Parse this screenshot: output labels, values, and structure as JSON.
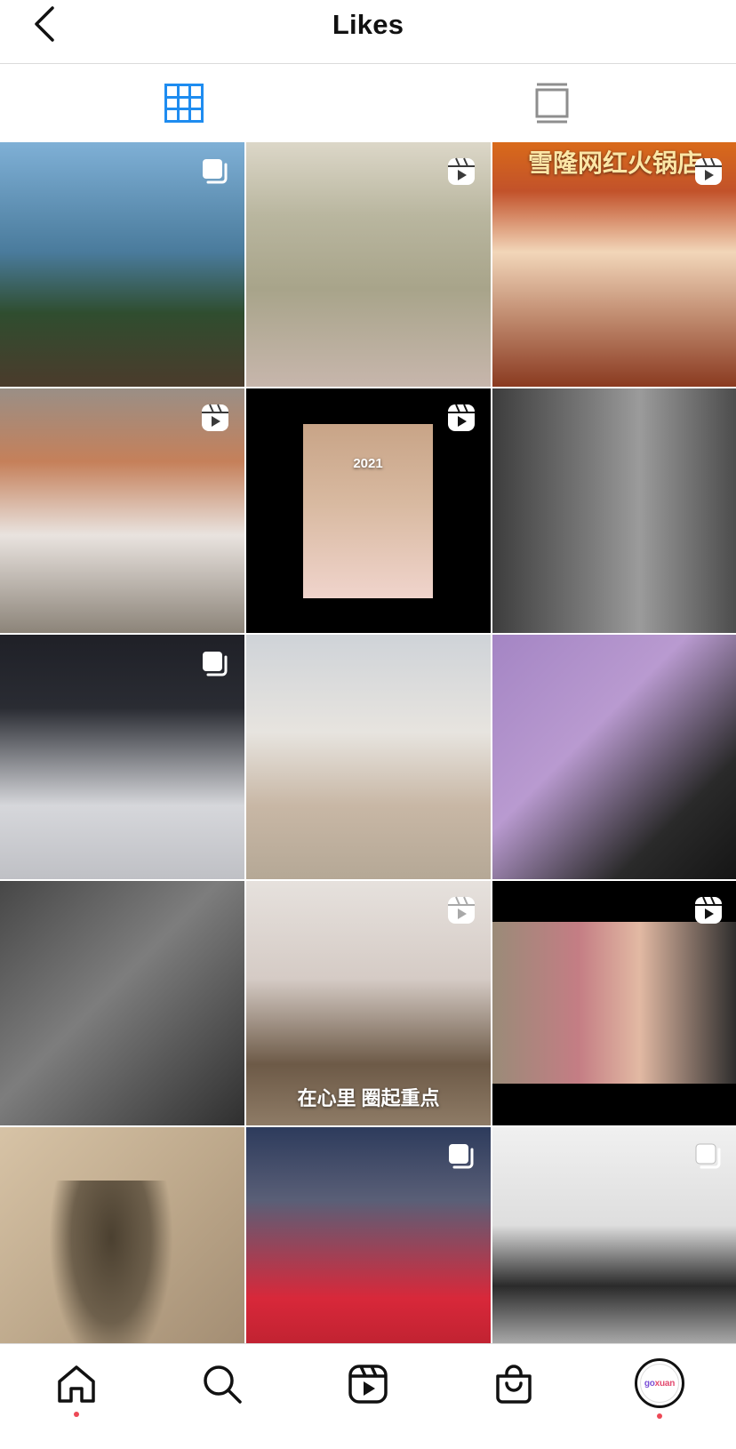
{
  "header": {
    "title": "Likes",
    "back_icon": "chevron-left-icon"
  },
  "tabs": [
    {
      "id": "grid",
      "icon": "grid-icon",
      "active": true
    },
    {
      "id": "feed",
      "icon": "single-post-icon",
      "active": false
    }
  ],
  "colors": {
    "active_tab": "#1e8cf0",
    "inactive_tab": "#8e8e8e",
    "notification_dot": "#ed4956"
  },
  "posts": [
    {
      "badge": "multi-photo-icon"
    },
    {
      "badge": "reel-icon"
    },
    {
      "badge": "reel-icon",
      "overlay": "雪隆网红火锅店"
    },
    {
      "badge": "reel-icon"
    },
    {
      "badge": "reel-icon",
      "overlay": "2021"
    },
    {
      "badge": ""
    },
    {
      "badge": "multi-photo-icon"
    },
    {
      "badge": ""
    },
    {
      "badge": ""
    },
    {
      "badge": ""
    },
    {
      "badge": "reel-icon",
      "overlay": "在心里 圈起重点"
    },
    {
      "badge": "reel-icon"
    },
    {
      "badge": ""
    },
    {
      "badge": "multi-photo-icon"
    },
    {
      "badge": "multi-photo-icon"
    }
  ],
  "bottom_nav": {
    "items": [
      {
        "id": "home",
        "icon": "home-icon",
        "dot": true
      },
      {
        "id": "search",
        "icon": "search-icon",
        "dot": false
      },
      {
        "id": "reels",
        "icon": "reels-icon",
        "dot": false
      },
      {
        "id": "shop",
        "icon": "shopping-bag-icon",
        "dot": false
      },
      {
        "id": "profile",
        "icon": "avatar",
        "dot": true
      }
    ],
    "profile_avatar_text_go": "go",
    "profile_avatar_text_xuan": "xuan"
  }
}
